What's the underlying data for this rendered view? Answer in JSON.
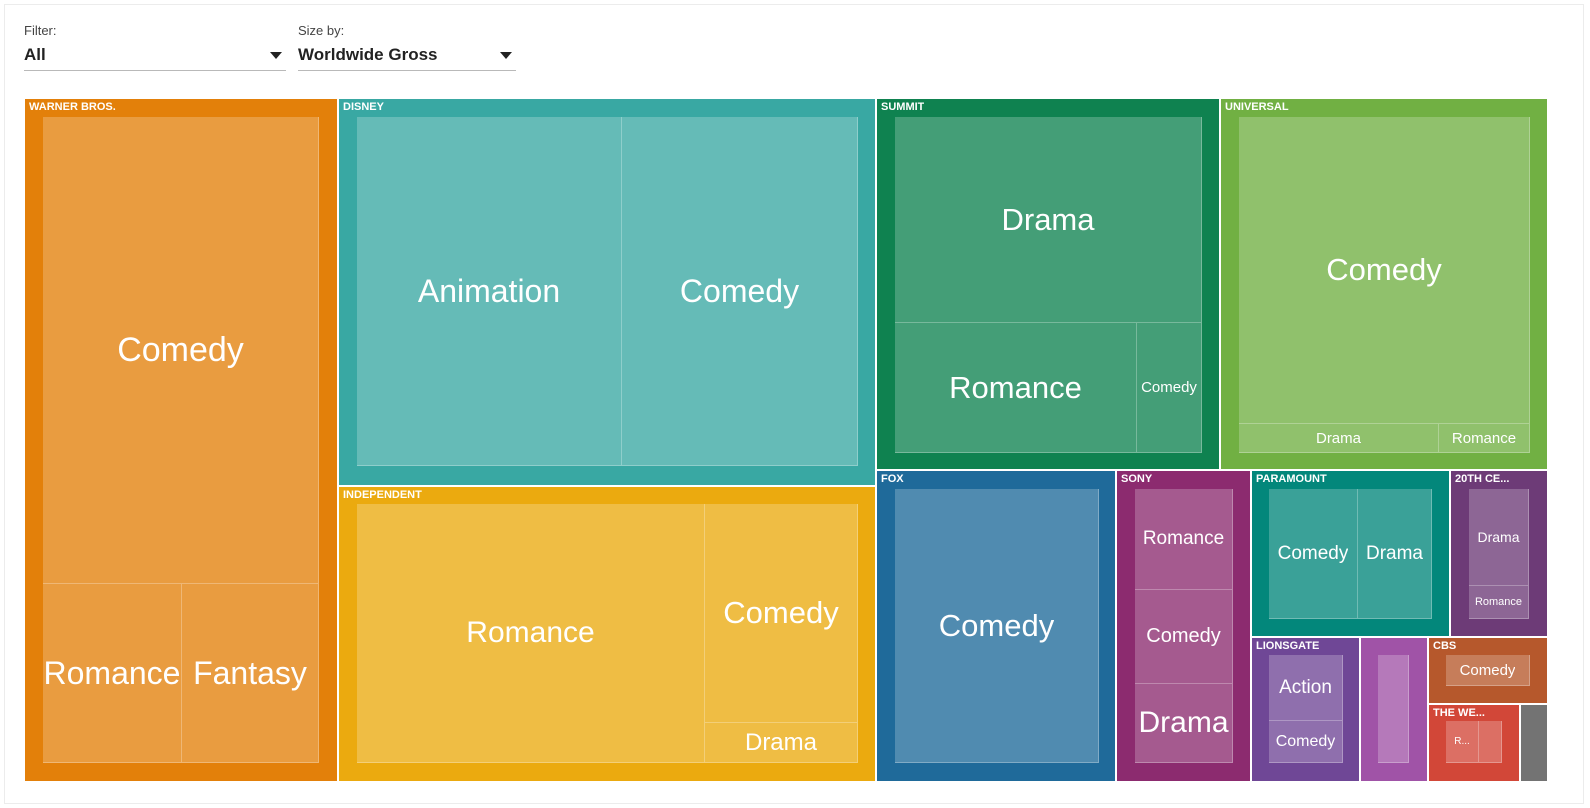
{
  "controls": {
    "filter": {
      "label": "Filter:",
      "value": "All"
    },
    "size_by": {
      "label": "Size by:",
      "value": "Worldwide Gross"
    }
  },
  "chart_data": {
    "type": "treemap",
    "title": "",
    "groups": [
      {
        "name": "WARNER BROS.",
        "color": "#e3800a",
        "children": [
          {
            "name": "Comedy",
            "value": 126
          },
          {
            "name": "Romance",
            "value": 25
          },
          {
            "name": "Fantasy",
            "value": 25
          }
        ]
      },
      {
        "name": "DISNEY",
        "color": "#39a8a3",
        "children": [
          {
            "name": "Animation",
            "value": 93
          },
          {
            "name": "Comedy",
            "value": 82
          }
        ]
      },
      {
        "name": "INDEPENDENT",
        "color": "#ebaa0f",
        "children": [
          {
            "name": "Romance",
            "value": 90
          },
          {
            "name": "Comedy",
            "value": 40
          },
          {
            "name": "Drama",
            "value": 8
          }
        ]
      },
      {
        "name": "SUMMIT",
        "color": "#0f8250",
        "children": [
          {
            "name": "Drama",
            "value": 64
          },
          {
            "name": "Romance",
            "value": 33
          },
          {
            "name": "Comedy",
            "value": 8
          }
        ]
      },
      {
        "name": "UNIVERSAL",
        "color": "#71b043",
        "children": [
          {
            "name": "Comedy",
            "value": 91
          },
          {
            "name": "Drama",
            "value": 6
          },
          {
            "name": "Romance",
            "value": 3
          }
        ]
      },
      {
        "name": "FOX",
        "color": "#1f6a9a",
        "children": [
          {
            "name": "Comedy",
            "value": 64
          }
        ]
      },
      {
        "name": "SONY",
        "color": "#8c2b6f",
        "children": [
          {
            "name": "Romance",
            "value": 11
          },
          {
            "name": "Comedy",
            "value": 11
          },
          {
            "name": "Drama",
            "value": 11
          }
        ]
      },
      {
        "name": "PARAMOUNT",
        "color": "#03877b",
        "children": [
          {
            "name": "Comedy",
            "value": 12
          },
          {
            "name": "Drama",
            "value": 11
          }
        ]
      },
      {
        "name": "20TH CE...",
        "color": "#6d3b77",
        "children": [
          {
            "name": "Drama",
            "value": 7
          },
          {
            "name": "Romance",
            "value": 3
          }
        ]
      },
      {
        "name": "LIONSGATE",
        "color": "#6f4796",
        "children": [
          {
            "name": "Action",
            "value": 8
          },
          {
            "name": "Comedy",
            "value": 5
          }
        ]
      },
      {
        "name": "",
        "color": "#a053a7",
        "children": [
          {
            "name": "",
            "value": 7
          }
        ]
      },
      {
        "name": "CBS",
        "color": "#b6582c",
        "children": [
          {
            "name": "Comedy",
            "value": 4
          }
        ]
      },
      {
        "name": "THE WE...",
        "color": "#d24738",
        "children": [
          {
            "name": "R...",
            "value": 3
          },
          {
            "name": "",
            "value": 1
          }
        ]
      },
      {
        "name": "",
        "color": "#737373",
        "children": []
      }
    ]
  }
}
